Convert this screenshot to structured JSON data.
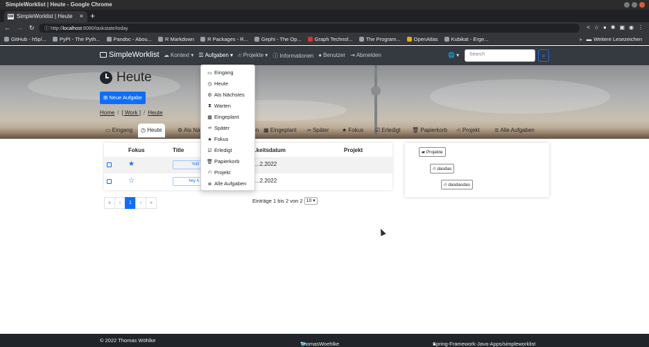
{
  "window": {
    "title": "SimpleWorklist | Heute - Google Chrome"
  },
  "browser": {
    "tab_title": "SimpleWorklist | Heute",
    "favicon_text": "SW",
    "url_prefix": "http://",
    "url_host": "localhost",
    "url_path": ":8080/taskstate/today",
    "bookmarks": [
      "GitHub - h5p/...",
      "PyPI - The Pyth...",
      "Pandoc - Abou...",
      "R Markdown",
      "R Packages - R...",
      "Gephi - The Op...",
      "Graph Technol...",
      "The Program...",
      "OpenAtlas",
      "Kubikat - Erge..."
    ],
    "bookmarks_more": "»",
    "other_bookmarks": "Weitere Lesezeichen"
  },
  "navbar": {
    "brand": "SimpleWorklist",
    "items": [
      "Kontext",
      "Aufgaben",
      "Projekte",
      "Informationen",
      "Benutzer",
      "Abmelden"
    ],
    "search_placeholder": "Search"
  },
  "page": {
    "title": "Heute",
    "new_task_button": "Neue Aufgabe",
    "breadcrumb": [
      "Home",
      "[ Work ]",
      "Heute"
    ]
  },
  "subtabs": [
    "Eingang",
    "Heute",
    "Als Nächstes",
    "Warten",
    "Eingeplant",
    "Später",
    "Fokus",
    "Erledigt",
    "Papierkorb",
    "Projekt",
    "Alle Aufgaben"
  ],
  "dropdown": [
    "Eingang",
    "Heute",
    "Als Nächstes",
    "Warten",
    "Eingeplant",
    "Später",
    "Fokus",
    "Erledigt",
    "Papierkorb",
    "Projekt",
    "Alle Aufgaben"
  ],
  "table": {
    "headers": [
      "Fokus",
      "Title",
      "...keitsdatum",
      "Projekt"
    ],
    "rows": [
      {
        "focused": true,
        "title": "Yolll",
        "date": "...2.2022"
      },
      {
        "focused": false,
        "title": "hey h",
        "date": "...2.2022"
      }
    ]
  },
  "pagination": {
    "first": "«",
    "prev": "‹",
    "current": "1",
    "next": "›",
    "last": "»"
  },
  "entries_info": {
    "text": "Einträge 1 bis 2 von 2",
    "page_size": "10"
  },
  "project_tree": [
    "Projekte",
    "dasdas",
    "dasdasdas"
  ],
  "footer": {
    "copyright": "© 2022 Thomas Wöhlke",
    "twitter": "ThomasWoehlke",
    "github": "Spring-Framework-Java-Apps/simpleworklist"
  },
  "colors": {
    "accent": "#0d6efd",
    "navbar": "#343a40",
    "footer": "#212529"
  }
}
